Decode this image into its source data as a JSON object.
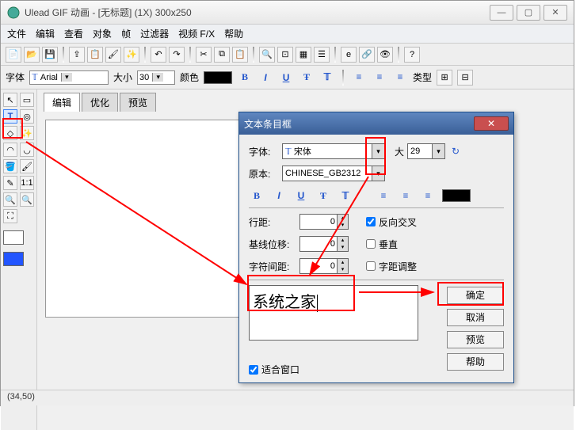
{
  "title": "Ulead GIF 动画 - [无标题] (1X) 300x250",
  "menus": [
    "文件",
    "编辑",
    "查看",
    "对象",
    "帧",
    "过滤器",
    "视频 F/X",
    "帮助"
  ],
  "fontbar": {
    "font_label": "字体",
    "font_value": "Arial",
    "size_label": "大小",
    "size_value": "30",
    "color_label": "颜色",
    "type_label": "类型"
  },
  "tabs": {
    "edit": "编辑",
    "optimize": "优化",
    "preview": "预览"
  },
  "status": "(34,50)",
  "dialog": {
    "title": "文本条目框",
    "font_label": "字体:",
    "font_value": "宋体",
    "big_label": "大",
    "big_value": "29",
    "orig_label": "原本:",
    "orig_value": "CHINESE_GB2312",
    "line_label": "行距:",
    "line_value": "0",
    "reverse_label": "反向交叉",
    "baseline_label": "基线位移:",
    "baseline_value": "0",
    "vertical_label": "垂直",
    "charspace_label": "字符间距:",
    "charspace_value": "0",
    "kerning_label": "字距调整",
    "text_value": "系统之家",
    "fit_label": "适合窗口",
    "btn_ok": "确定",
    "btn_cancel": "取消",
    "btn_preview": "预览",
    "btn_help": "帮助"
  }
}
